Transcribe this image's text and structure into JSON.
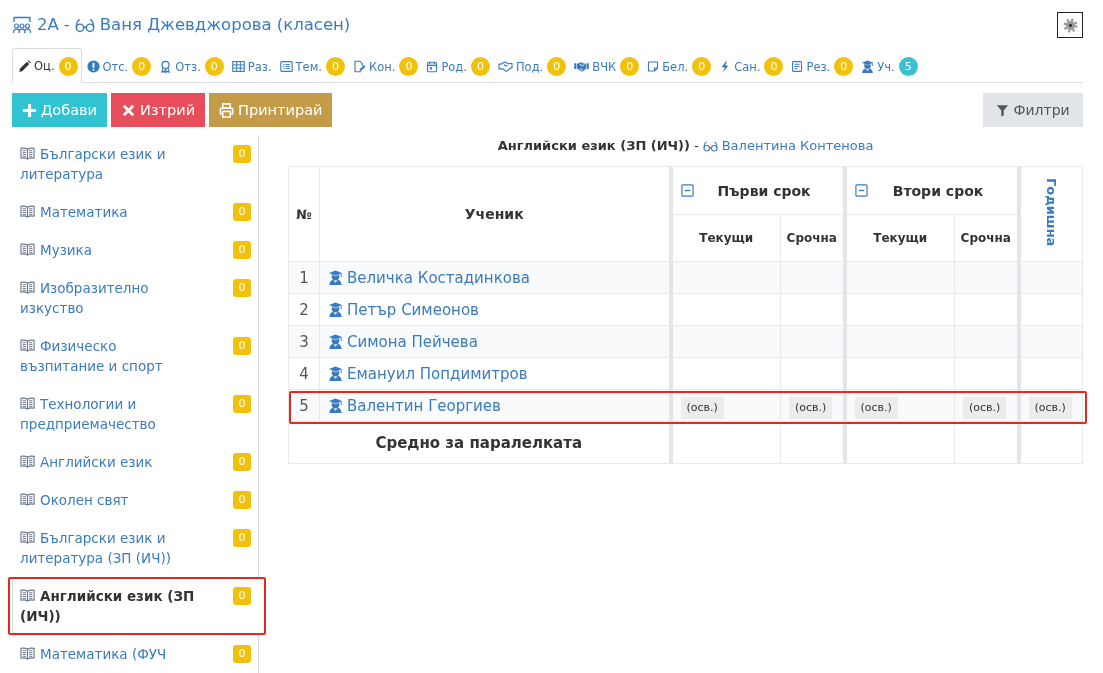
{
  "header": {
    "class_name": "2А",
    "separator": "-",
    "teacher": "Ваня Джевджорова (класен)"
  },
  "tabs": [
    {
      "label": "Оц.",
      "count": "0",
      "color": "#f0c20c",
      "selected": true
    },
    {
      "label": "Отс.",
      "count": "0",
      "color": "#f0c20c",
      "selected": false
    },
    {
      "label": "Отз.",
      "count": "0",
      "color": "#f0c20c",
      "selected": false
    },
    {
      "label": "Раз.",
      "selected": false
    },
    {
      "label": "Тем.",
      "count": "0",
      "color": "#f0c20c",
      "selected": false
    },
    {
      "label": "Кон.",
      "count": "0",
      "color": "#f0c20c",
      "selected": false
    },
    {
      "label": "Род.",
      "count": "0",
      "color": "#f0c20c",
      "selected": false
    },
    {
      "label": "Под.",
      "count": "0",
      "color": "#f0c20c",
      "selected": false
    },
    {
      "label": "ВЧК",
      "count": "0",
      "color": "#f0c20c",
      "selected": false
    },
    {
      "label": "Бел.",
      "count": "0",
      "color": "#f0c20c",
      "selected": false
    },
    {
      "label": "Сан.",
      "count": "0",
      "color": "#f0c20c",
      "selected": false
    },
    {
      "label": "Рез.",
      "count": "0",
      "color": "#f0c20c",
      "selected": false
    },
    {
      "label": "Уч.",
      "count": "5",
      "color": "#3bc0cf",
      "selected": false
    }
  ],
  "toolbar": {
    "buttons": [
      {
        "label": "Добави",
        "kind": "add"
      },
      {
        "label": "Изтрий",
        "kind": "delete"
      },
      {
        "label": "Принтирай",
        "kind": "print"
      }
    ],
    "filter_button": "Филтри"
  },
  "sidebar": {
    "items": [
      {
        "label": "Български език и литература",
        "count": "0",
        "selected": false,
        "highlighted": false
      },
      {
        "label": "Математика",
        "count": "0",
        "selected": false,
        "highlighted": false
      },
      {
        "label": "Музика",
        "count": "0",
        "selected": false,
        "highlighted": false
      },
      {
        "label": "Изобразително изкуство",
        "count": "0",
        "selected": false,
        "highlighted": false
      },
      {
        "label": "Физическо възпитание и спорт",
        "count": "0",
        "selected": false,
        "highlighted": false
      },
      {
        "label": "Технологии и предприемачество",
        "count": "0",
        "selected": false,
        "highlighted": false
      },
      {
        "label": "Английски език",
        "count": "0",
        "selected": false,
        "highlighted": false
      },
      {
        "label": "Околен свят",
        "count": "0",
        "selected": false,
        "highlighted": false
      },
      {
        "label": "Български език и литература (ЗП (ИЧ))",
        "count": "0",
        "selected": false,
        "highlighted": false
      },
      {
        "label": "Английски език (ЗП (ИЧ))",
        "count": "0",
        "selected": true,
        "highlighted": true
      },
      {
        "label": "Математика (ФУЧ",
        "count": "0",
        "selected": false,
        "highlighted": false
      }
    ]
  },
  "subject_heading": {
    "subject": "Английски език (ЗП (ИЧ))",
    "separator": "-",
    "teacher": "Валентина Контенова"
  },
  "table": {
    "columns": [
      {
        "label": "№",
        "kind": "index"
      },
      {
        "label": "Ученик",
        "kind": "name"
      },
      {
        "label": "Първи срок",
        "kind": "term",
        "expanded": true,
        "subcolumns": [
          {
            "label": "Текущи"
          },
          {
            "label": "Срочна"
          }
        ]
      },
      {
        "label": "Втори срок",
        "kind": "term",
        "expanded": true,
        "subcolumns": [
          {
            "label": "Текущи"
          },
          {
            "label": "Срочна"
          }
        ]
      },
      {
        "label": "Годишна",
        "kind": "final"
      }
    ],
    "rows": [
      {
        "number": "1",
        "student": "Величка Костадинкова",
        "highlighted": false
      },
      {
        "number": "2",
        "student": "Петър Симеонов",
        "highlighted": false
      },
      {
        "number": "3",
        "student": "Симона Пейчева",
        "highlighted": false
      },
      {
        "number": "4",
        "student": "Емануил Попдимитров",
        "highlighted": false
      },
      {
        "number": "5",
        "student": "Валентин Георгиев",
        "highlighted": true,
        "grades": [
          "(осв.)",
          "(осв.)",
          "(осв.)",
          "(осв.)",
          "(осв.)"
        ]
      }
    ],
    "footer_label": "Средно за паралелката"
  }
}
